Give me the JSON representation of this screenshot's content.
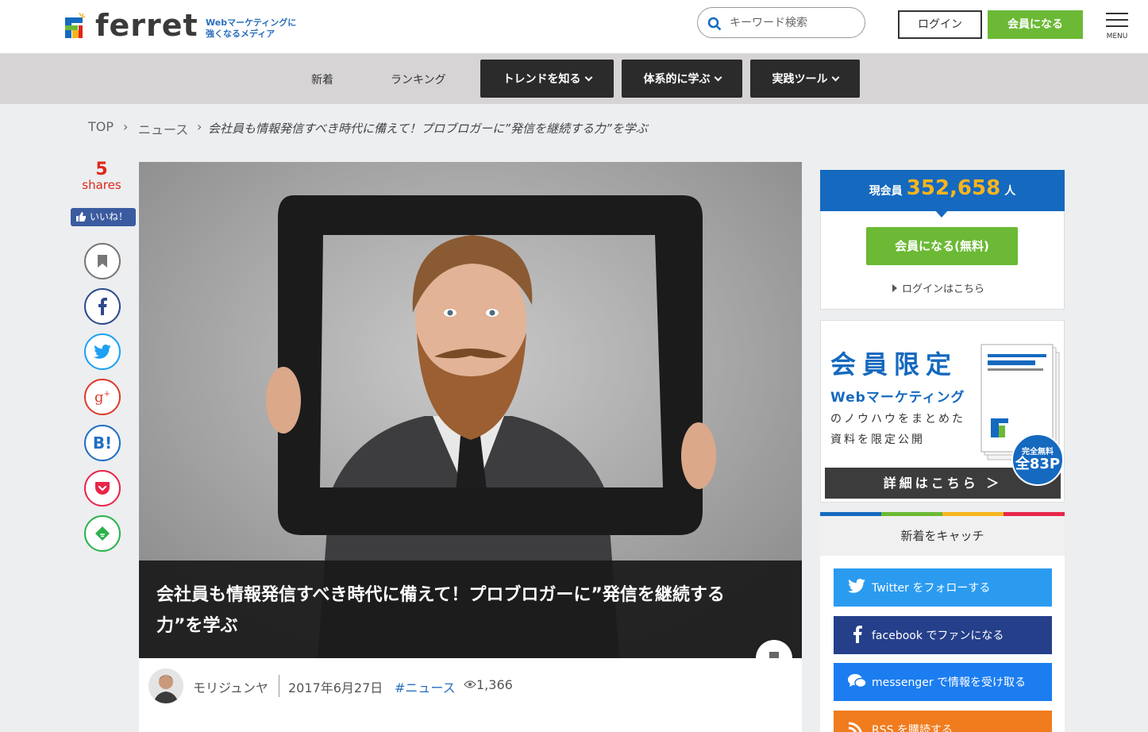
{
  "header": {
    "logo_text": "ferret",
    "tagline_1": "Webマーケティングに",
    "tagline_2": "強くなるメディア",
    "search_placeholder": "キーワード検索",
    "login_label": "ログイン",
    "join_label": "会員になる",
    "menu_label": "MENU"
  },
  "nav": {
    "items": [
      {
        "label": "新着"
      },
      {
        "label": "ランキング"
      },
      {
        "label": "トレンドを知る"
      },
      {
        "label": "体系的に学ぶ"
      },
      {
        "label": "実践ツール"
      }
    ]
  },
  "breadcrumb": {
    "items": [
      "TOP",
      "ニュース"
    ],
    "separator": "›",
    "current": "会社員も情報発信すべき時代に備えて！プロブロガーに”発信を継続する力”を学ぶ"
  },
  "share": {
    "count": "5",
    "count_label": "shares",
    "like_label": "いいね！",
    "buttons": [
      {
        "icon": "bookmark-icon",
        "color": "#777777"
      },
      {
        "icon": "facebook-icon",
        "color": "#2d4a8a"
      },
      {
        "icon": "twitter-icon",
        "color": "#1da1f2"
      },
      {
        "icon": "google-plus-icon",
        "color": "#dd3b2a"
      },
      {
        "icon": "hatena-bookmark-icon",
        "color": "#1f6fc4"
      },
      {
        "icon": "pocket-icon",
        "color": "#e8264a"
      },
      {
        "icon": "feedly-icon",
        "color": "#2bb24c"
      }
    ]
  },
  "article": {
    "title": "会社員も情報発信すべき時代に備えて！プロブロガーに”発信を継続する力”を学ぶ",
    "author": "モリジュンヤ",
    "date": "2017年6月27日",
    "tag": "#ニュース",
    "views": "1,366"
  },
  "sidebar": {
    "member_prefix": "現会員",
    "member_count": "352,658",
    "member_suffix": "人",
    "free_join_label": "会員になる(無料)",
    "login_link": "ログインはこちら",
    "banner": {
      "title": "会員限定",
      "subtitle": "Webマーケティング",
      "line1": "のノウハウをまとめた",
      "line2": "資料を限定公開",
      "cta": "詳細はこちら ＞",
      "badge_1": "完全無料",
      "badge_2": "全83P"
    },
    "catch_title": "新着をキャッチ",
    "sns": [
      {
        "label": "Twitter をフォローする",
        "color": "#2b9bf0"
      },
      {
        "label": "facebook でファンになる",
        "color": "#253f8a"
      },
      {
        "label": "messenger で情報を受け取る",
        "color": "#1c7df0"
      },
      {
        "label": "RSS を購読する",
        "color": "#f07c1e"
      }
    ]
  }
}
